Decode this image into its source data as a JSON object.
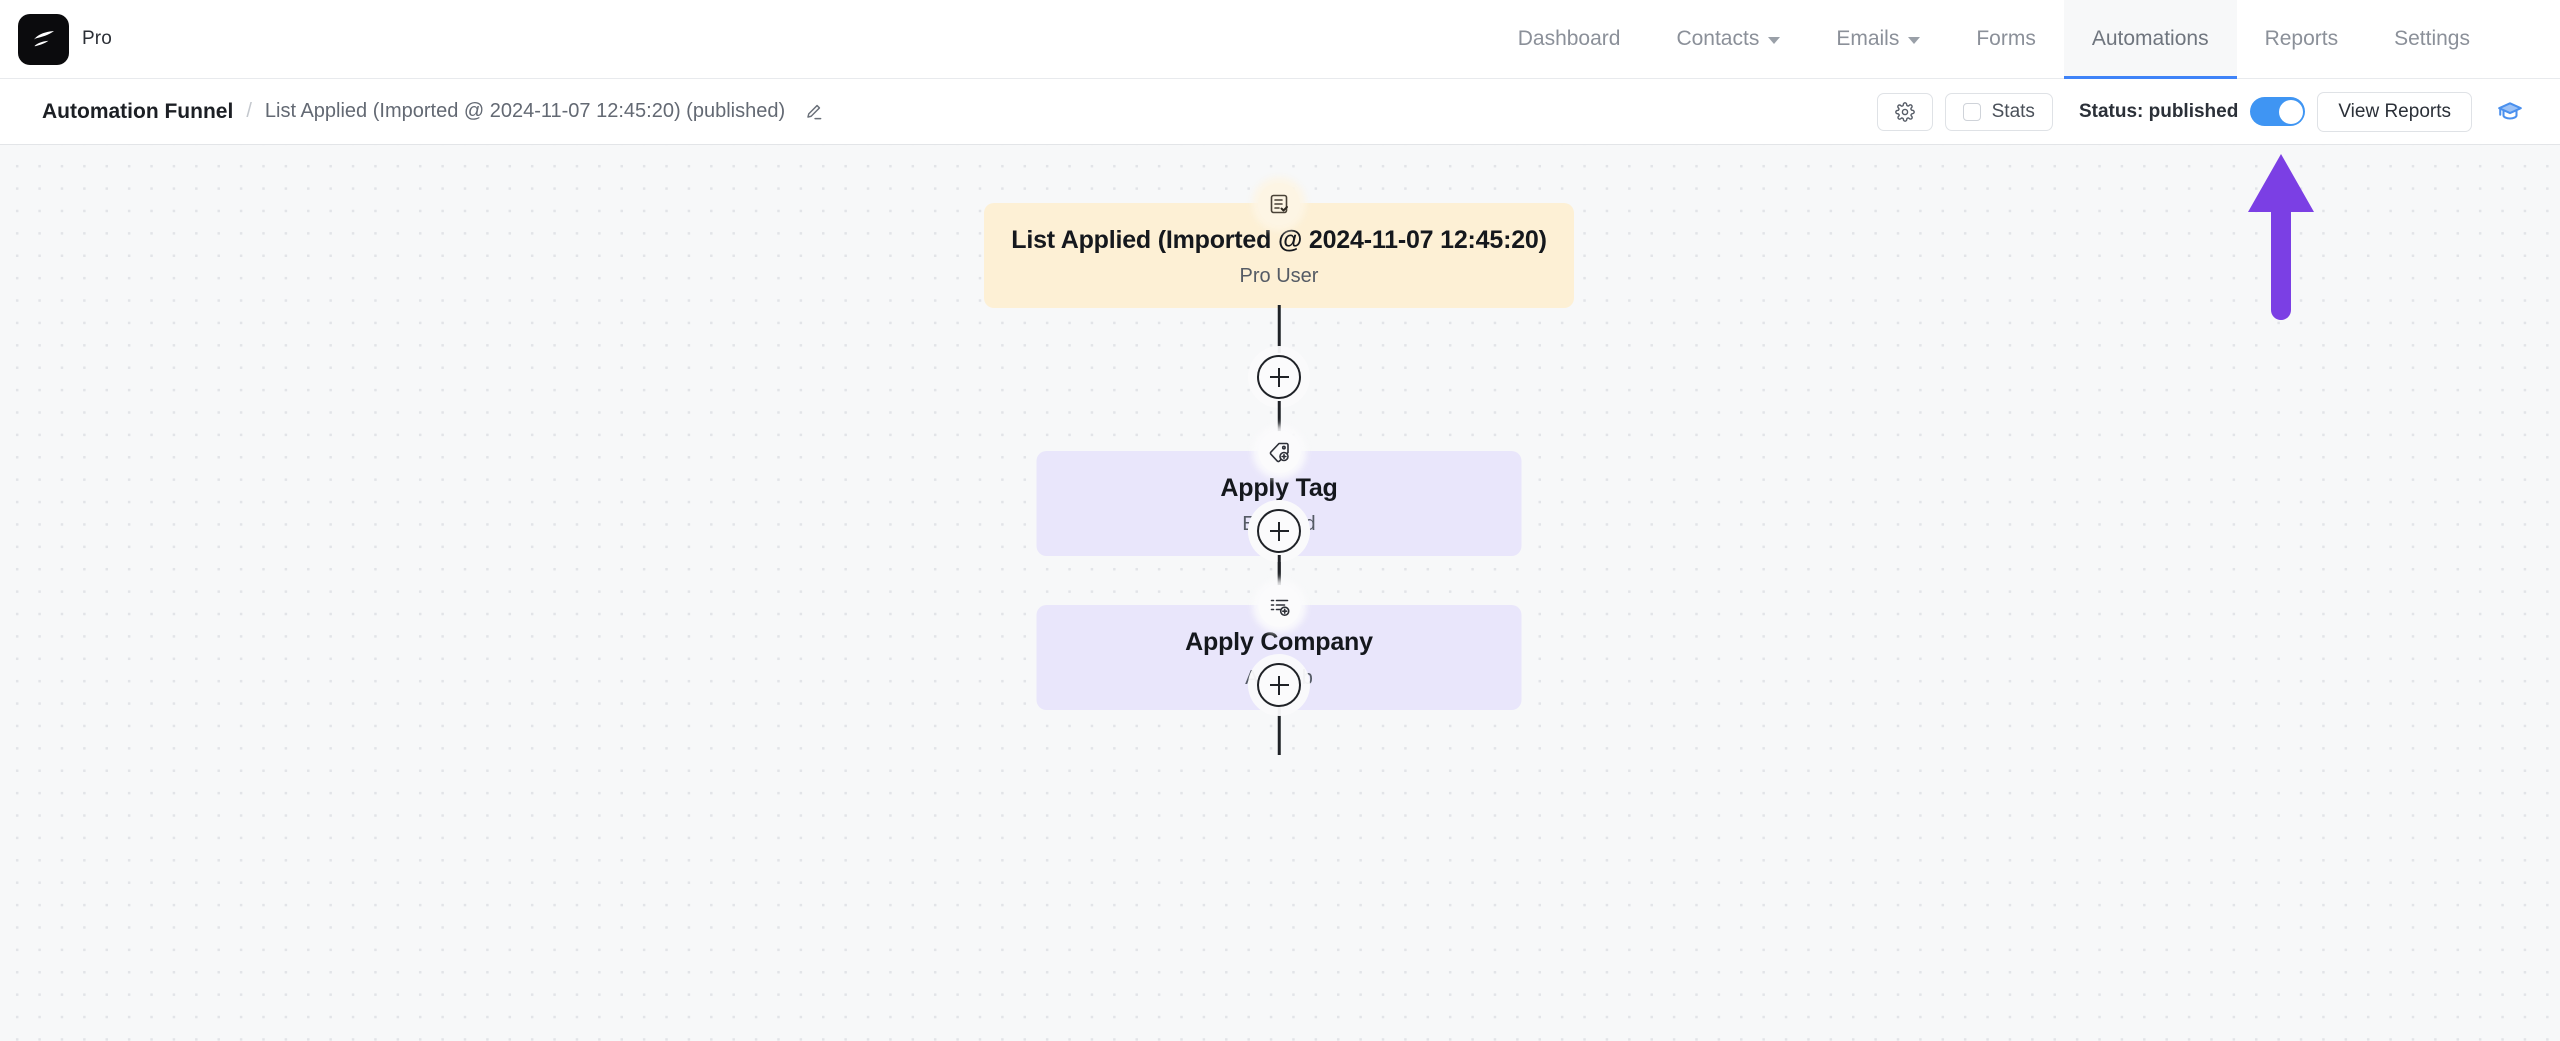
{
  "brand": {
    "label": "Pro",
    "logo_icon": "swoosh-logo-icon",
    "logo_bg": "#0b0b0d"
  },
  "nav": {
    "items": [
      {
        "label": "Dashboard",
        "has_caret": false,
        "active": false
      },
      {
        "label": "Contacts",
        "has_caret": true,
        "active": false
      },
      {
        "label": "Emails",
        "has_caret": true,
        "active": false
      },
      {
        "label": "Forms",
        "has_caret": false,
        "active": false
      },
      {
        "label": "Automations",
        "has_caret": false,
        "active": true
      },
      {
        "label": "Reports",
        "has_caret": false,
        "active": false
      },
      {
        "label": "Settings",
        "has_caret": false,
        "active": false
      }
    ],
    "active_underline_color": "#3f83f8"
  },
  "toolbar": {
    "breadcrumb_root": "Automation Funnel",
    "breadcrumb_separator": "/",
    "breadcrumb_leaf": "List Applied (Imported @ 2024-11-07 12:45:20) (published)",
    "edit_icon": "pencil-icon",
    "settings_icon": "gear-icon",
    "stats_label": "Stats",
    "stats_checked": false,
    "status_label": "Status: published",
    "status_toggle_on": true,
    "status_toggle_color": "#3f95f3",
    "view_reports_label": "View Reports",
    "help_icon": "graduation-cap-icon",
    "help_icon_color": "#4a90ee"
  },
  "canvas": {
    "background": "#f7f8f9",
    "dot_color": "#e2e4e8",
    "annotation": {
      "type": "arrow-up",
      "color": "#7b3fe4",
      "points_at": "status-toggle"
    },
    "nodes": [
      {
        "kind": "trigger",
        "icon": "clipboard-check-icon",
        "title": "List Applied (Imported @ 2024-11-07 12:45:20)",
        "subtitle": "Pro User",
        "color": "#fdf0d5"
      },
      {
        "kind": "action",
        "icon": "tag-plus-icon",
        "title": "Apply Tag",
        "subtitle": "Enrolled",
        "color": "#e9e6fb"
      },
      {
        "kind": "action",
        "icon": "list-plus-icon",
        "title": "Apply Company",
        "subtitle": "Authlab",
        "color": "#e9e6fb"
      }
    ],
    "add_buttons": [
      {
        "label": "+",
        "name": "add-step-after-trigger"
      },
      {
        "label": "+",
        "name": "add-step-after-apply-tag"
      },
      {
        "label": "+",
        "name": "add-step-after-apply-company"
      }
    ]
  }
}
